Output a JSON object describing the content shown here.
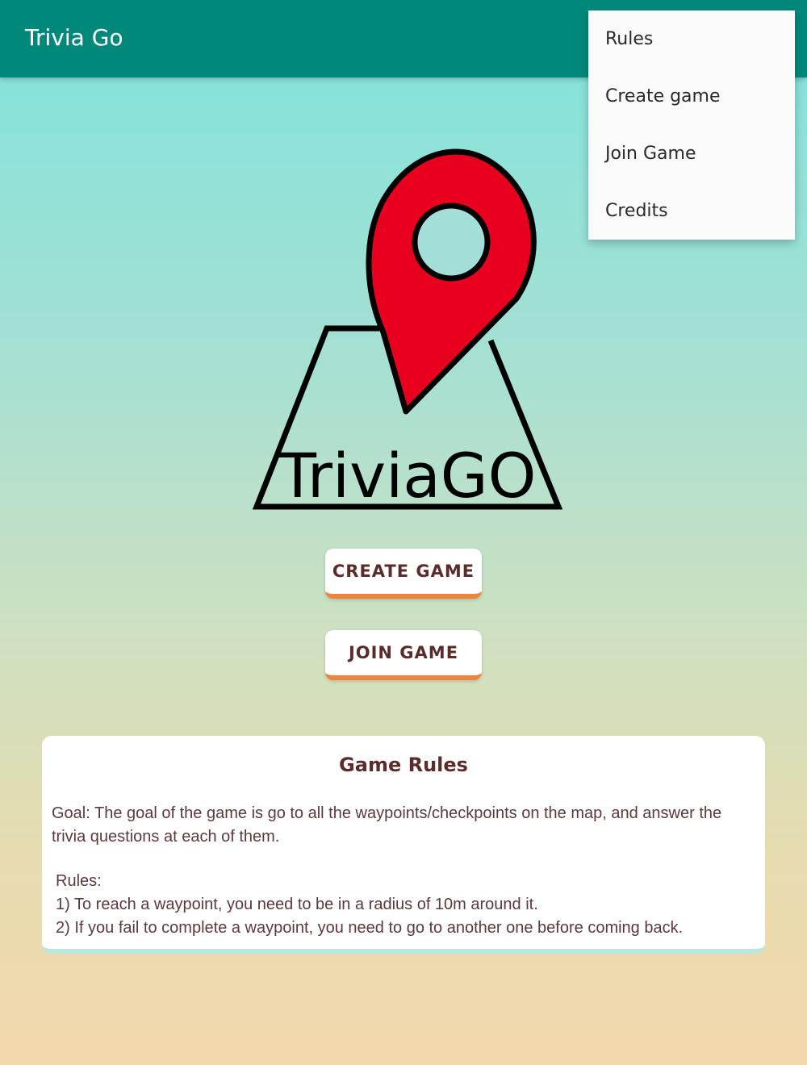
{
  "appbar": {
    "title": "Trivia Go"
  },
  "menu": {
    "items": [
      {
        "label": "Rules"
      },
      {
        "label": "Create game"
      },
      {
        "label": "Join Game"
      },
      {
        "label": "Credits"
      }
    ]
  },
  "logo": {
    "text": "TriviaGO",
    "pin_color": "#e8001e"
  },
  "buttons": {
    "create": "CREATE GAME",
    "join": "JOIN GAME"
  },
  "rules_card": {
    "title": "Game Rules",
    "goal": "Goal: The goal of the game is go to all the waypoints/checkpoints on the map, and answer the trivia questions at each of them.",
    "rules_heading": "Rules:",
    "rule_1": "1) To reach a waypoint, you need to be in a radius of 10m around it.",
    "rule_2": "2) If you fail to complete a waypoint, you need to go to another one before coming back."
  },
  "colors": {
    "appbar": "#00897b",
    "button_accent": "#f0843a",
    "button_text": "#5a2c2c"
  }
}
